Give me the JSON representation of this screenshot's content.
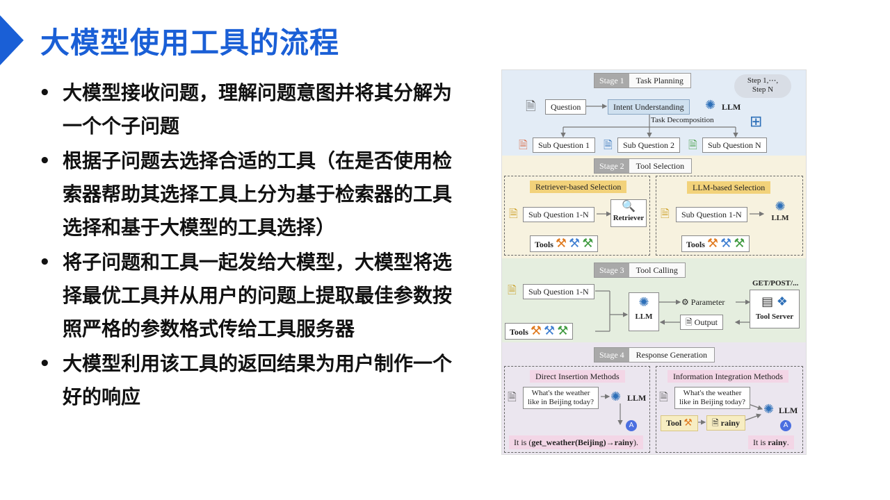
{
  "title": "大模型使用工具的流程",
  "bullets": [
    "大模型接收问题，理解问题意图并将其分解为一个个子问题",
    "根据子问题去选择合适的工具（在是否使用检索器帮助其选择工具上分为基于检索器的工具选择和基于大模型的工具选择）",
    "将子问题和工具一起发给大模型，大模型将选择最优工具并从用户的问题上提取最佳参数按照严格的参数格式传给工具服务器",
    "大模型利用该工具的返回结果为用户制作一个好的响应"
  ],
  "diagram": {
    "stage1": {
      "num": "Stage 1",
      "name": "Task Planning",
      "step_note_line1": "Step 1,⋯,",
      "step_note_line2": "Step N",
      "question": "Question",
      "intent": "Intent Understanding",
      "llm": "LLM",
      "task_decomp": "Task Decomposition",
      "sub1": "Sub Question 1",
      "sub2": "Sub Question 2",
      "subn": "Sub Question N"
    },
    "stage2": {
      "num": "Stage 2",
      "name": "Tool Selection",
      "retriever_based": "Retriever-based Selection",
      "llm_based": "LLM-based Selection",
      "sub_q": "Sub Question 1-N",
      "retriever": "Retriever",
      "llm": "LLM",
      "tools": "Tools"
    },
    "stage3": {
      "num": "Stage 3",
      "name": "Tool Calling",
      "sub_q": "Sub Question 1-N",
      "tools": "Tools",
      "llm": "LLM",
      "parameter": "Parameter",
      "output": "Output",
      "get_post": "GET/POST/...",
      "tool_server": "Tool Server"
    },
    "stage4": {
      "num": "Stage 4",
      "name": "Response Generation",
      "direct": "Direct Insertion Methods",
      "integration": "Information Integration Methods",
      "weather_q1": "What's the weather",
      "weather_q2": "like in Beijing today?",
      "llm": "LLM",
      "tool": "Tool",
      "rainy": "rainy",
      "answer_direct_pre": "It is (",
      "answer_direct_call": "get_weather(Beijing)→rainy",
      "answer_direct_post": ").",
      "answer_int_pre": "It is ",
      "answer_int_val": "rainy",
      "answer_int_post": "."
    }
  },
  "colors": {
    "accent": "#1a5fd6"
  }
}
